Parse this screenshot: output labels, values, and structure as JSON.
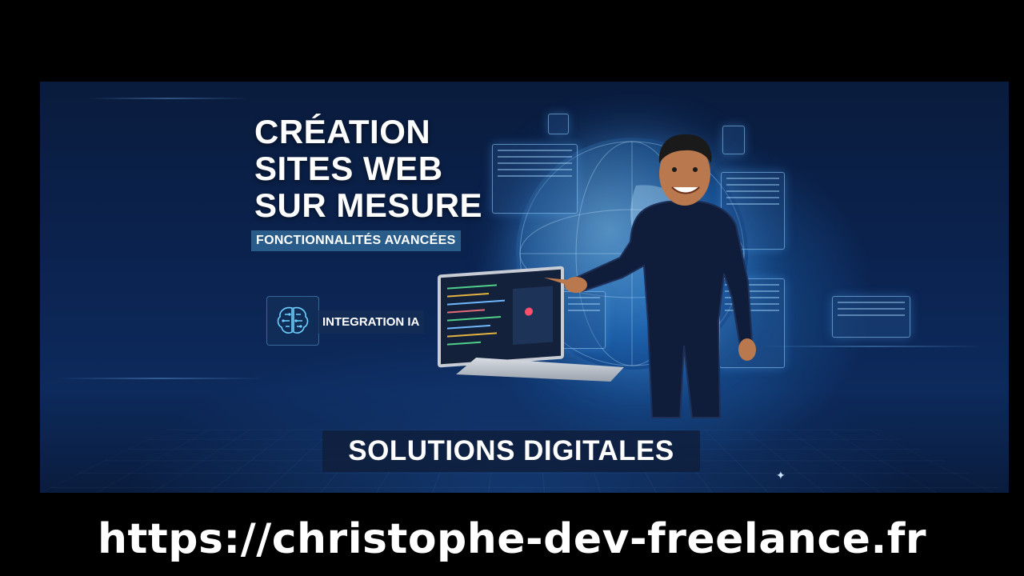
{
  "banner": {
    "headline": [
      "CRÉATION",
      "SITES WEB",
      "SUR MESURE"
    ],
    "subtag": "FONCTIONNALITÉS AVANCÉES",
    "ai_feature": {
      "label": "INTEGRATION IA",
      "icon": "brain-circuit-icon"
    },
    "bottom_label": "SOLUTIONS DIGITALES"
  },
  "url": "https://christophe-dev-freelance.fr",
  "colors": {
    "background": "#000000",
    "banner_bg": "#0b2350",
    "accent": "#3a8fd8",
    "text": "#ffffff"
  }
}
